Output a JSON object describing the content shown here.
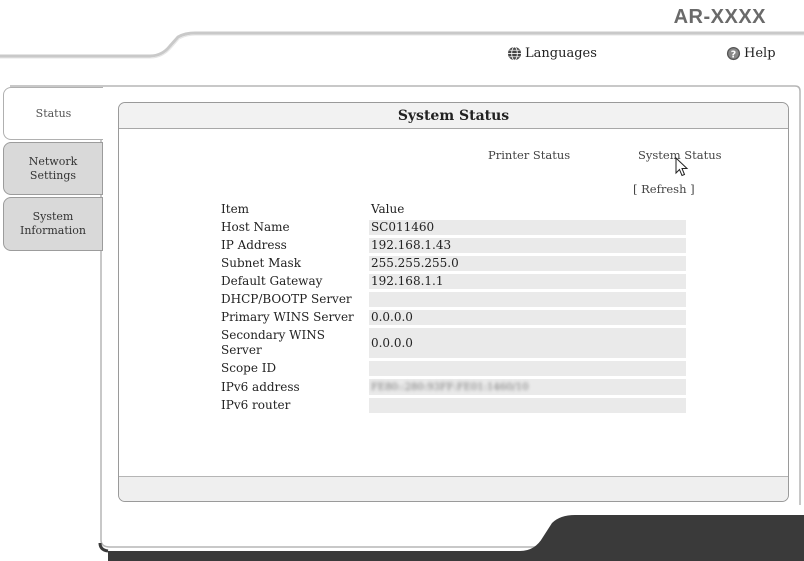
{
  "header": {
    "model": "AR-XXXX",
    "languages_label": "Languages",
    "help_label": "Help"
  },
  "sidebar": {
    "items": [
      {
        "label": "Status",
        "active": true
      },
      {
        "label": "Network Settings",
        "active": false
      },
      {
        "label_line1": "System",
        "label_line2": "Information",
        "active": false
      }
    ]
  },
  "panel": {
    "title": "System Status",
    "links": {
      "printer_status": "Printer Status",
      "system_status": "System Status",
      "refresh": "[ Refresh ]"
    },
    "table": {
      "headers": {
        "item": "Item",
        "value": "Value"
      },
      "rows": [
        {
          "item": "Host Name",
          "value": "SC011460"
        },
        {
          "item": "IP Address",
          "value": "192.168.1.43"
        },
        {
          "item": "Subnet Mask",
          "value": "255.255.255.0"
        },
        {
          "item": "Default Gateway",
          "value": "192.168.1.1"
        },
        {
          "item": "DHCP/BOOTP Server",
          "value": ""
        },
        {
          "item": "Primary WINS Server",
          "value": "0.0.0.0"
        },
        {
          "item": "Secondary WINS Server",
          "value": "0.0.0.0"
        },
        {
          "item": "Scope ID",
          "value": ""
        },
        {
          "item": "IPv6 address",
          "value": "FE80::280:93FF:FE01:1460/10"
        },
        {
          "item": "IPv6 router",
          "value": ""
        }
      ]
    }
  },
  "colors": {
    "frame_dark": "#3a3a3a",
    "tab_inactive": "#d9d9d9",
    "row_bg": "#eaeaea",
    "header_bar": "#f2f2f2"
  },
  "icons": {
    "languages": "globe-icon",
    "help": "question-circle-icon",
    "pointer": "mouse-cursor-icon"
  }
}
